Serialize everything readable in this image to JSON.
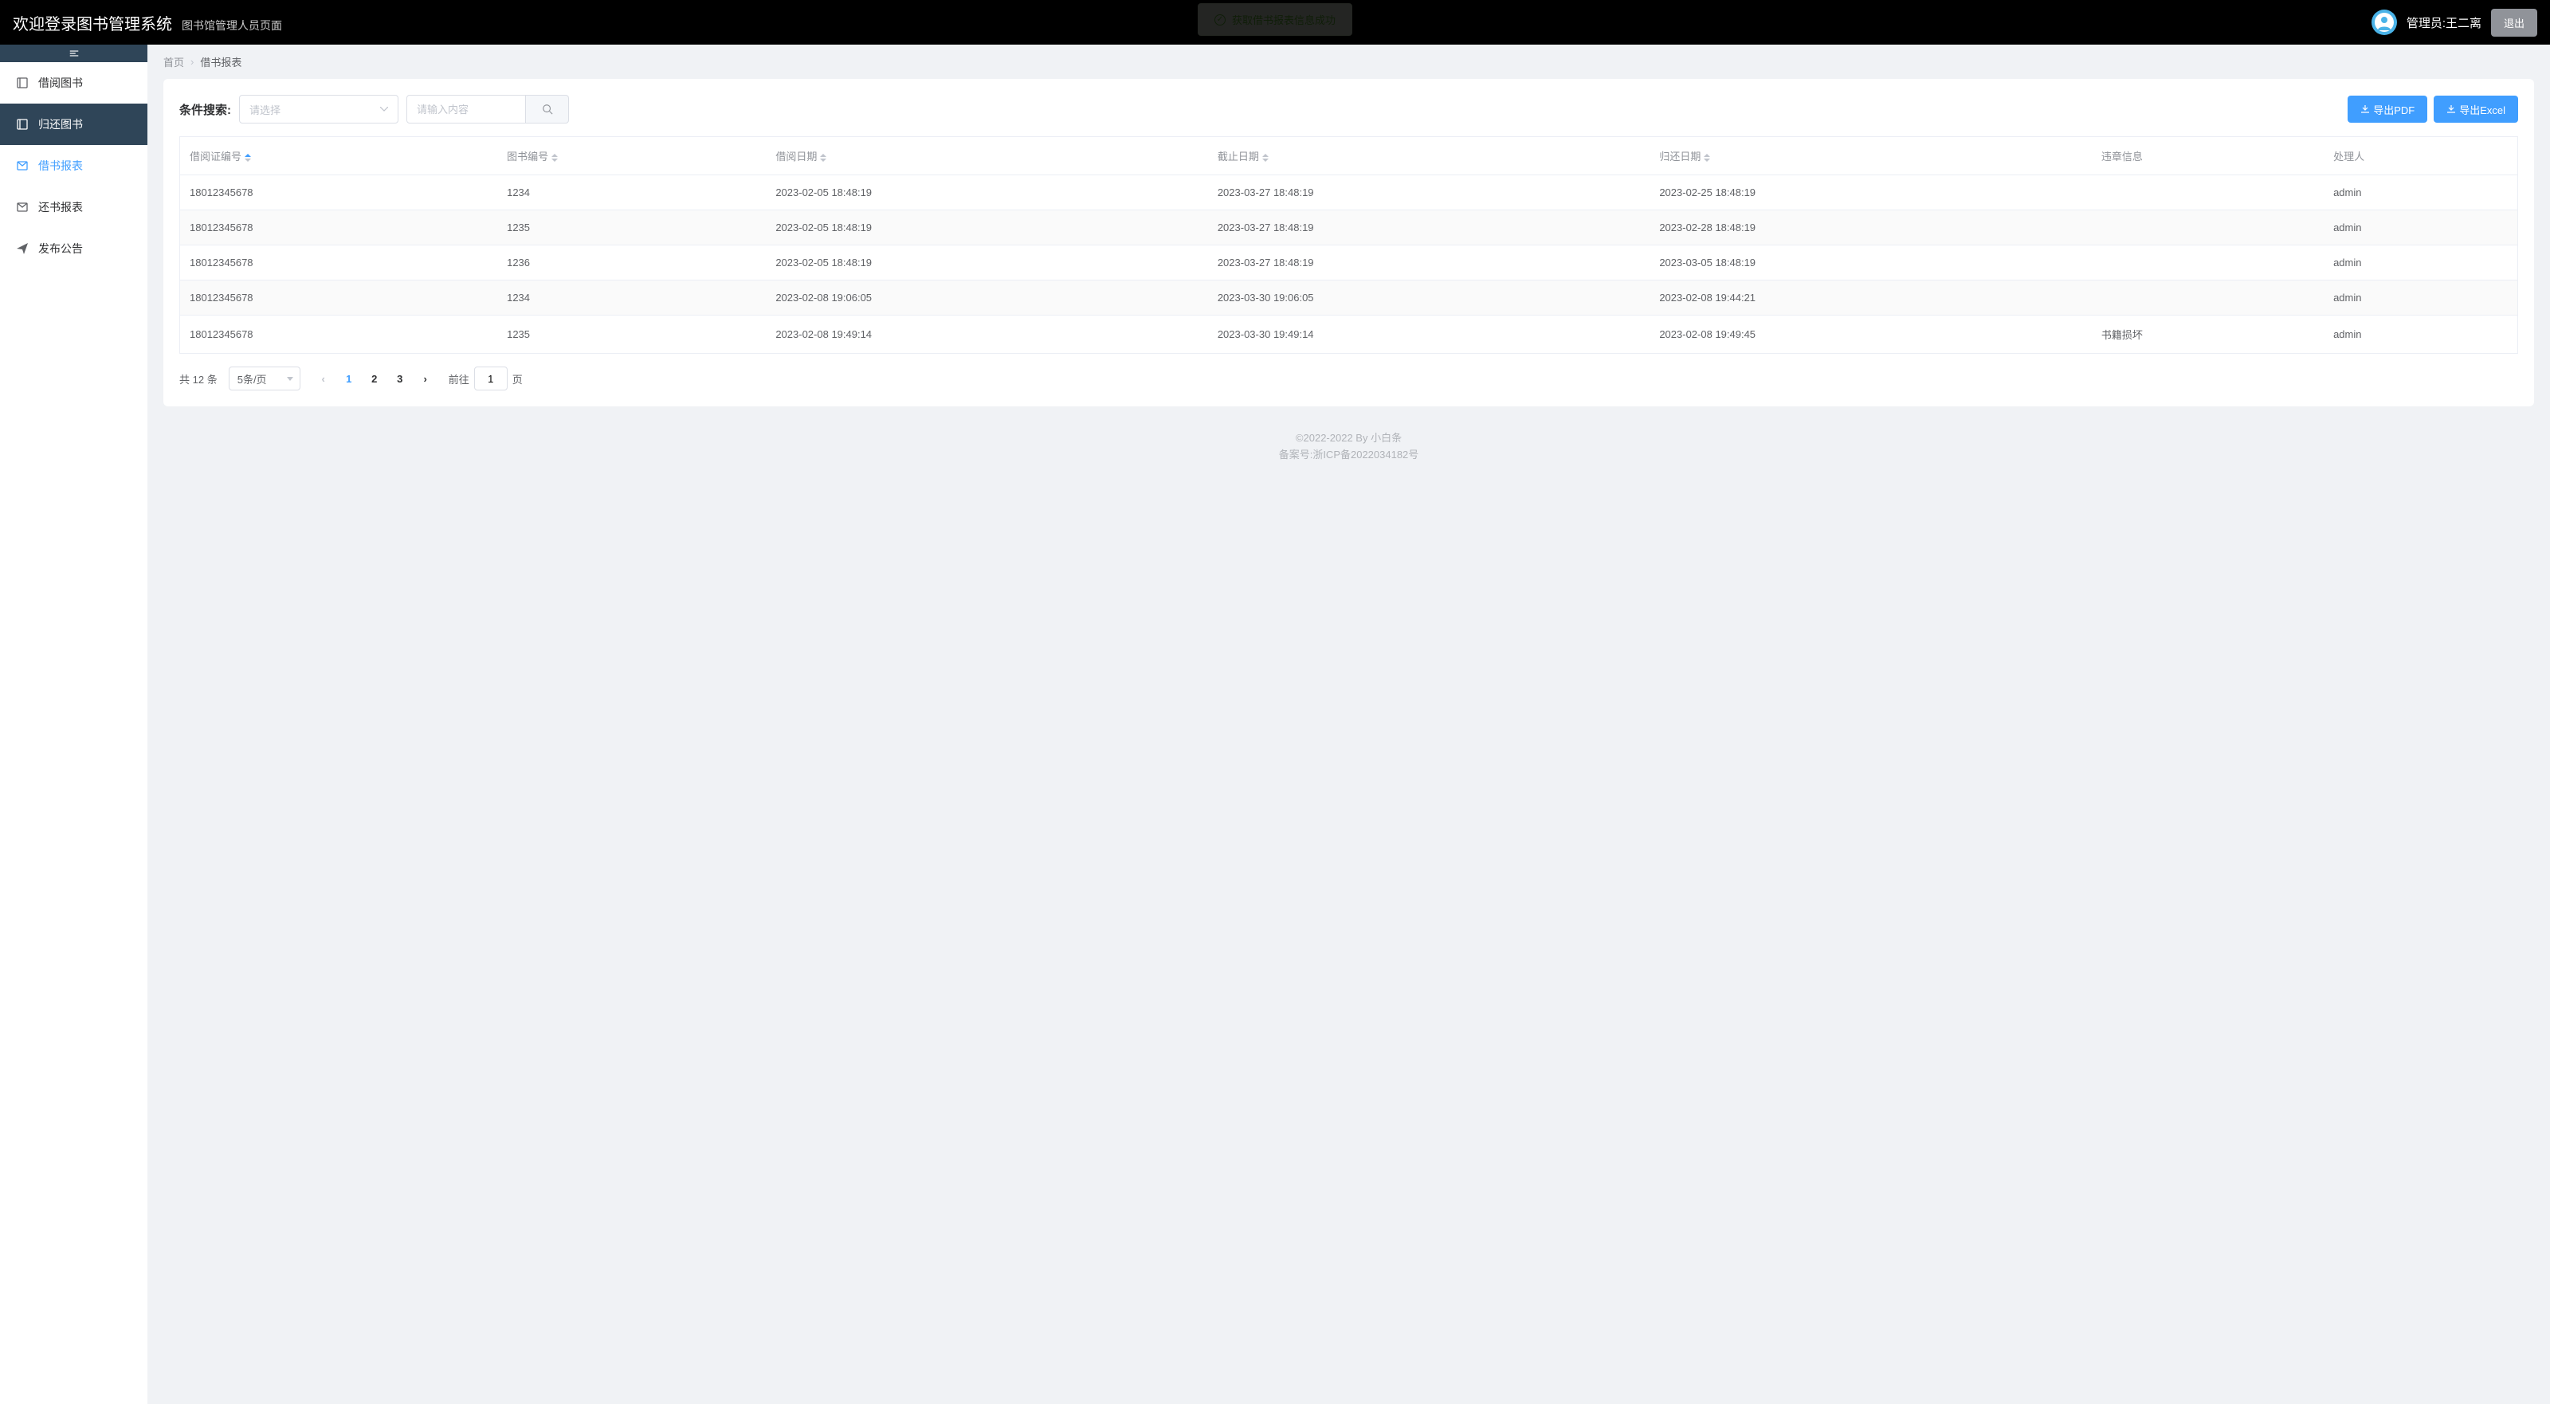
{
  "header": {
    "title": "欢迎登录图书管理系统",
    "subtitle": "图书馆管理人员页面",
    "admin_label": "管理员:王二离",
    "logout": "退出"
  },
  "toast": "获取借书报表信息成功",
  "sidebar": {
    "items": [
      {
        "label": "借阅图书",
        "icon": "book"
      },
      {
        "label": "归还图书",
        "icon": "book"
      },
      {
        "label": "借书报表",
        "icon": "report"
      },
      {
        "label": "还书报表",
        "icon": "report"
      },
      {
        "label": "发布公告",
        "icon": "send"
      }
    ]
  },
  "breadcrumb": {
    "home": "首页",
    "current": "借书报表"
  },
  "toolbar": {
    "label": "条件搜索:",
    "select_placeholder": "请选择",
    "input_placeholder": "请输入内容",
    "export_pdf": "导出PDF",
    "export_excel": "导出Excel"
  },
  "table": {
    "columns": [
      "借阅证编号",
      "图书编号",
      "借阅日期",
      "截止日期",
      "归还日期",
      "违章信息",
      "处理人"
    ],
    "rows": [
      {
        "card_no": "18012345678",
        "book_id": "1234",
        "borrow_date": "2023-02-05 18:48:19",
        "due_date": "2023-03-27 18:48:19",
        "return_date": "2023-02-25 18:48:19",
        "violation": "",
        "handler": "admin"
      },
      {
        "card_no": "18012345678",
        "book_id": "1235",
        "borrow_date": "2023-02-05 18:48:19",
        "due_date": "2023-03-27 18:48:19",
        "return_date": "2023-02-28 18:48:19",
        "violation": "",
        "handler": "admin"
      },
      {
        "card_no": "18012345678",
        "book_id": "1236",
        "borrow_date": "2023-02-05 18:48:19",
        "due_date": "2023-03-27 18:48:19",
        "return_date": "2023-03-05 18:48:19",
        "violation": "",
        "handler": "admin"
      },
      {
        "card_no": "18012345678",
        "book_id": "1234",
        "borrow_date": "2023-02-08 19:06:05",
        "due_date": "2023-03-30 19:06:05",
        "return_date": "2023-02-08 19:44:21",
        "violation": "",
        "handler": "admin"
      },
      {
        "card_no": "18012345678",
        "book_id": "1235",
        "borrow_date": "2023-02-08 19:49:14",
        "due_date": "2023-03-30 19:49:14",
        "return_date": "2023-02-08 19:49:45",
        "violation": "书籍损坏",
        "handler": "admin"
      }
    ]
  },
  "pagination": {
    "total_prefix": "共 ",
    "total": "12",
    "total_suffix": " 条",
    "page_size": "5条/页",
    "pages": [
      "1",
      "2",
      "3"
    ],
    "current": "1",
    "jump_prefix": "前往",
    "jump_value": "1",
    "jump_suffix": "页"
  },
  "footer": {
    "line1": "©2022-2022 By 小白条",
    "line2": "备案号:浙ICP备2022034182号"
  }
}
